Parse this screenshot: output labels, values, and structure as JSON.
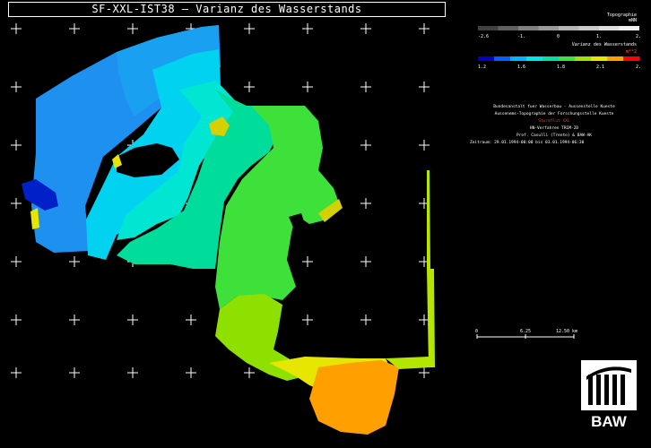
{
  "title": "SF-XXL-IST38 – Varianz des Wasserstands",
  "legend_topography": {
    "label": "Topographie",
    "unit": "mNN",
    "ticks": [
      "-2.6",
      "-1.",
      "0",
      "1.",
      "2.6"
    ],
    "colors": [
      "#404040",
      "#606060",
      "#808080",
      "#9a9a9a",
      "#b4b4b4",
      "#cacaca",
      "#dedede",
      "#f0f0f0"
    ]
  },
  "legend_variance": {
    "label": "Varianz des Wasserstands",
    "unit": "m**2",
    "ticks": [
      "1.2",
      "1.6",
      "1.8",
      "2.1",
      "2.6"
    ],
    "colors": [
      "#0000c8",
      "#0060ff",
      "#00b4ff",
      "#00e6e6",
      "#00e0a0",
      "#40e040",
      "#a0e000",
      "#e6e600",
      "#ffa000",
      "#ff0000"
    ]
  },
  "institution": {
    "line1": "Bundesanstalt fuer Wasserbau - Aussenstelle Kueste",
    "line2": "Aussenems-Topographie der Forschungsstelle Kueste",
    "line3": "Sturmflut XXL",
    "line4": "HN-Verfahren TRIM-2D",
    "line5": "Prof. Casulli (Trento) & BAW-AK",
    "line6": "Zeitraum: 29.01.1994-00:00 bis 03.01.1994-06:30"
  },
  "scale_bar": {
    "ticks": [
      "0",
      "6.25",
      "12.50 km"
    ]
  },
  "logo": {
    "text": "BAW"
  },
  "colors": {
    "blue": "#1e8cf0",
    "light_blue": "#00c8ff",
    "cyan": "#00e6e6",
    "teal": "#00dc96",
    "green": "#46e028",
    "lime": "#9ee000",
    "yellow": "#e6e600",
    "orange": "#ffa000"
  }
}
